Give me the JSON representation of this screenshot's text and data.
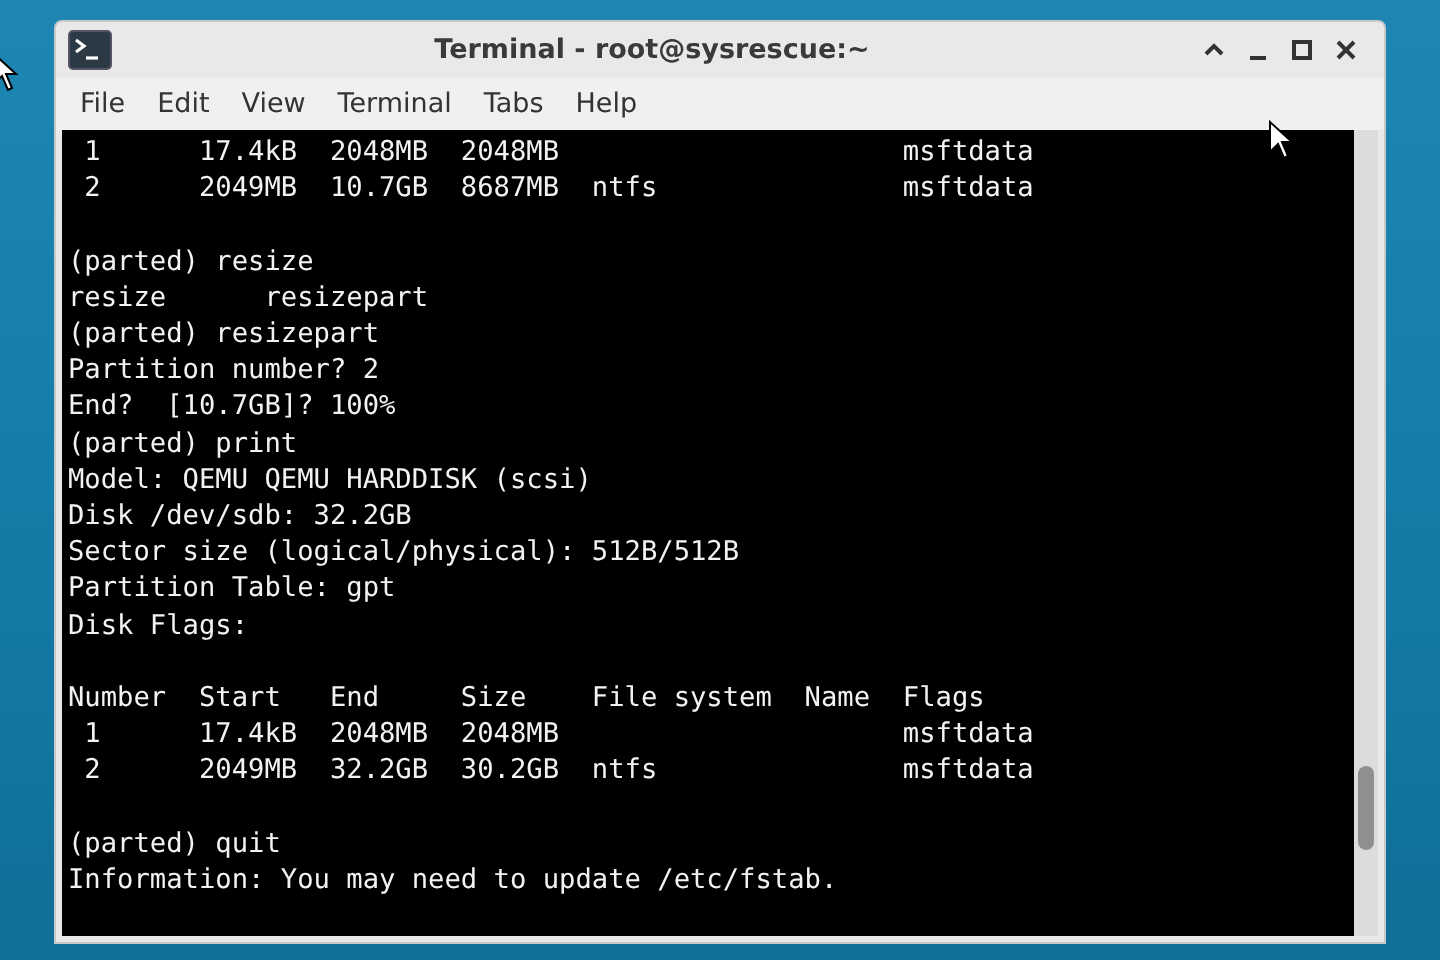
{
  "window": {
    "title": "Terminal - root@sysrescue:~"
  },
  "menu": [
    "File",
    "Edit",
    "View",
    "Terminal",
    "Tabs",
    "Help"
  ],
  "terminal": {
    "blocks": [
      [
        " 1      17.4kB  2048MB  2048MB                     msftdata",
        " 2      2049MB  10.7GB  8687MB  ntfs               msftdata"
      ],
      [
        "(parted) resize",
        "resize      resizepart",
        "(parted) resizepart",
        "Partition number? 2",
        "End?  [10.7GB]? 100%",
        "(parted) print",
        "Model: QEMU QEMU HARDDISK (scsi)",
        "Disk /dev/sdb: 32.2GB",
        "Sector size (logical/physical): 512B/512B",
        "Partition Table: gpt",
        "Disk Flags:"
      ],
      [
        "Number  Start   End     Size    File system  Name  Flags",
        " 1      17.4kB  2048MB  2048MB                     msftdata",
        " 2      2049MB  32.2GB  30.2GB  ntfs               msftdata"
      ],
      [
        "(parted) quit",
        "Information: You may need to update /etc/fstab."
      ]
    ]
  }
}
